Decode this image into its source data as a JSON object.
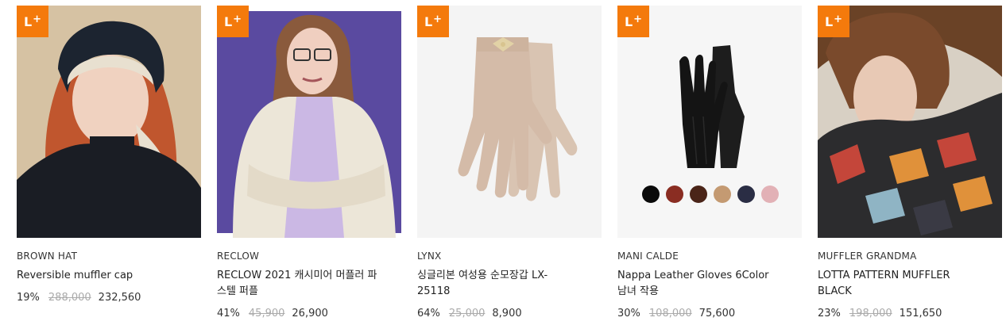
{
  "badge": {
    "label": "L",
    "plus": "+"
  },
  "products": [
    {
      "brand": "BROWN HAT",
      "name": "Reversible muffler cap",
      "discount": "19%",
      "original_price": "288,000",
      "price": "232,560",
      "image": "woman-wearing-muffler-cap"
    },
    {
      "brand": "RECLOW",
      "name": "RECLOW 2021 캐시미어 머플러 파스텔 퍼플",
      "discount": "41%",
      "original_price": "45,900",
      "price": "26,900",
      "image": "woman-wearing-purple-scarf"
    },
    {
      "brand": "LYNX",
      "name": "싱글리본 여성용 순모장갑 LX-25118",
      "discount": "64%",
      "original_price": "25,000",
      "price": "8,900",
      "image": "beige-wool-gloves"
    },
    {
      "brand": "MANI CALDE",
      "name": "Nappa Leather Gloves 6Color 남녀 작용",
      "discount": "30%",
      "original_price": "108,000",
      "price": "75,600",
      "image": "black-leather-gloves",
      "swatches": [
        "#0a0a0a",
        "#8a2d22",
        "#4a2418",
        "#c49a72",
        "#2a2d44",
        "#e2b1b6"
      ]
    },
    {
      "brand": "MUFFLER GRANDMA",
      "name": "LOTTA PATTERN MUFFLER BLACK",
      "discount": "23%",
      "original_price": "198,000",
      "price": "151,650",
      "image": "man-wearing-patterned-muffler"
    }
  ]
}
